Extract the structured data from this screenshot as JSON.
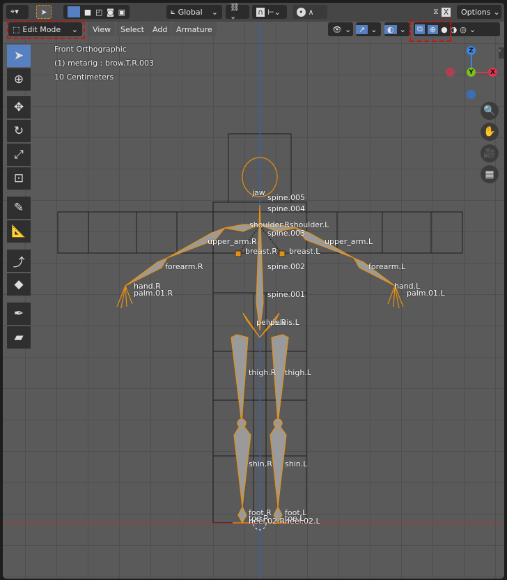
{
  "header": {
    "transform_orientation": "Global",
    "options_label": "Options",
    "x_mirror_label": "X"
  },
  "mode_selector": {
    "value": "Edit Mode"
  },
  "menus": [
    "View",
    "Select",
    "Add",
    "Armature"
  ],
  "overlay_info": {
    "view": "Front Orthographic",
    "object": "(1) metarig : brow.T.R.003",
    "scale": "10 Centimeters"
  },
  "gizmo": {
    "z": "Z",
    "y": "Y",
    "x": "X"
  },
  "colors": {
    "accent": "#5680c2",
    "bone": "#e8900f",
    "x_axis": "#e0344e",
    "y_axis": "#7bbf1a",
    "z_axis": "#3a86e8",
    "highlight": "#d01010"
  },
  "bones": {
    "spine005": "spine.005",
    "spine004": "spine.004",
    "shoulder": "shoulder.Rshoulder.L",
    "spine003": "spine.003",
    "upper_arm_r": "upper_arm.R",
    "upper_arm_l": "upper_arm.L",
    "breast_r": "breast.R",
    "breast_l": "breast.L",
    "forearm_r": "forearm.R",
    "forearm_l": "forearm.L",
    "spine002": "spine.002",
    "spine001": "spine.001",
    "hand_r": "hand.R",
    "hand_l": "hand.L",
    "palm_r": "palm.01.R",
    "palm_l": "palm.01.L",
    "pelvis_r": "pelvis.R",
    "pelvis_l": "pelvis.L",
    "thigh_r": "thigh.R",
    "thigh_l": "thigh.L",
    "shin_r": "shin.R",
    "shin_l": "shin.L",
    "foot_r": "foot.R",
    "foot_l": "foot.L",
    "toe_r": "toe.R",
    "toe_l": "toe.L",
    "heel_r": "heel.02.R",
    "heel_l": "heel.02.L",
    "jaw": "jaw"
  }
}
